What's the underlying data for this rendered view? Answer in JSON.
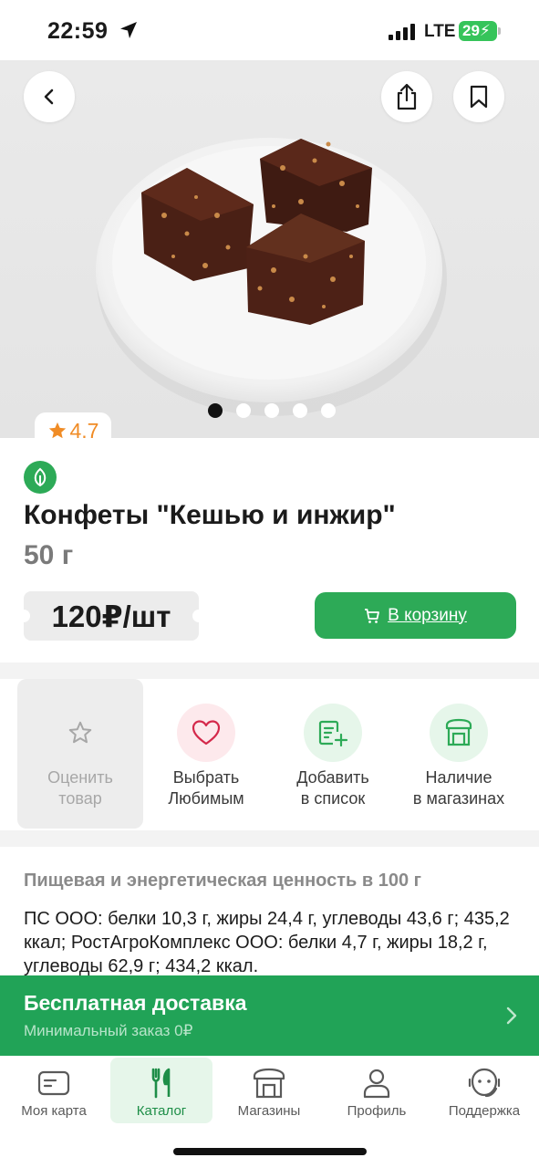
{
  "status_bar": {
    "time": "22:59",
    "network": "LTE",
    "battery": "29"
  },
  "gallery": {
    "slide_count": 5,
    "active_slide": 1
  },
  "rating": {
    "value": "4.7"
  },
  "product": {
    "title": "Конфеты \"Кешью и инжир\"",
    "weight": "50 г",
    "price": "120₽/шт",
    "cart_button": "В корзину"
  },
  "actions": [
    {
      "label": "Оценить\nтовар",
      "icon": "star-icon",
      "enabled": false
    },
    {
      "label": "Выбрать\nЛюбимым",
      "icon": "heart-icon",
      "enabled": true
    },
    {
      "label": "Добавить\nв список",
      "icon": "add-list-icon",
      "enabled": true
    },
    {
      "label": "Наличие\nв магазинах",
      "icon": "store-icon",
      "enabled": true
    }
  ],
  "nutrition": {
    "title": "Пищевая и энергетическая ценность в 100 г",
    "text": "ПС ООО: белки 10,3 г, жиры 24,4 г, углеводы 43,6 г; 435,2 ккал; РостАгроКомплекс ООО: белки 4,7 г, жиры 18,2 г, углеводы 62,9 г; 434,2 ккал."
  },
  "delivery": {
    "title": "Бесплатная доставка",
    "subtitle": "Минимальный заказ",
    "min_order": "0₽"
  },
  "tabbar": [
    {
      "label": "Моя карта",
      "icon": "card-icon",
      "active": false
    },
    {
      "label": "Каталог",
      "icon": "fork-knife-icon",
      "active": true
    },
    {
      "label": "Магазины",
      "icon": "shop-icon",
      "active": false
    },
    {
      "label": "Профиль",
      "icon": "user-icon",
      "active": false
    },
    {
      "label": "Поддержка",
      "icon": "support-icon",
      "active": false
    }
  ],
  "colors": {
    "brand_green": "#2daa57",
    "rating_orange": "#f08c26",
    "heart_pink": "#fde9ec"
  }
}
